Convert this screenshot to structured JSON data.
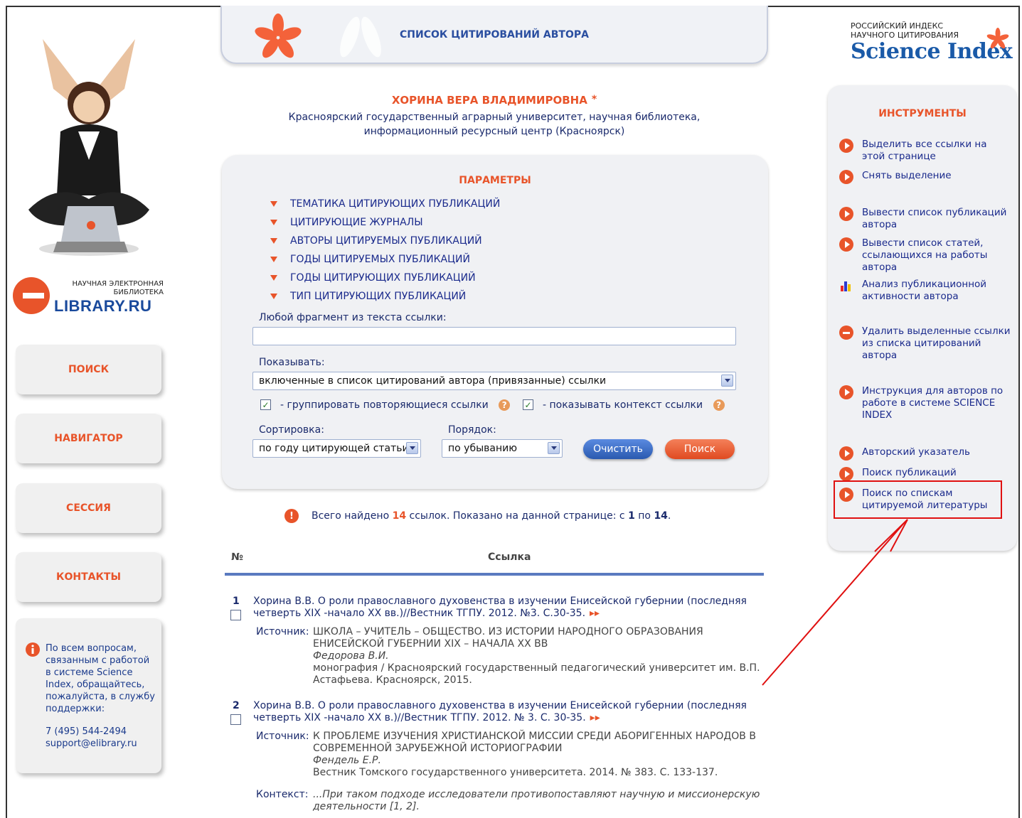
{
  "header": {
    "title": "СПИСОК ЦИТИРОВАНИЙ АВТОРА"
  },
  "author": {
    "name": "ХОРИНА ВЕРА ВЛАДИМИРОВНА",
    "org": "Красноярский государственный аграрный университет, научная библиотека, информационный ресурсный центр (Красноярск)"
  },
  "left": {
    "logo_tagline": "НАУЧНАЯ ЭЛЕКТРОННАЯ БИБЛИОТЕКА",
    "logo_brand": "LIBRARY.RU",
    "nav": [
      "ПОИСК",
      "НАВИГАТОР",
      "СЕССИЯ",
      "КОНТАКТЫ"
    ],
    "support_text": "По всем вопросам, связанным с работой в системе Science Index, обращайтесь, пожалуйста, в службу поддержки:",
    "phone": "7 (495) 544-2494",
    "email": "support@elibrary.ru"
  },
  "params": {
    "title": "ПАРАМЕТРЫ",
    "items": [
      "ТЕМАТИКА ЦИТИРУЮЩИХ ПУБЛИКАЦИЙ",
      "ЦИТИРУЮЩИЕ ЖУРНАЛЫ",
      "АВТОРЫ ЦИТИРУЕМЫХ ПУБЛИКАЦИЙ",
      "ГОДЫ ЦИТИРУЕМЫХ ПУБЛИКАЦИЙ",
      "ГОДЫ ЦИТИРУЮЩИХ ПУБЛИКАЦИЙ",
      "ТИП ЦИТИРУЮЩИХ ПУБЛИКАЦИЙ"
    ],
    "fragment_label": "Любой фрагмент из текста ссылки:",
    "fragment_value": "",
    "show_label": "Показывать:",
    "show_value": "включенные в список цитирований автора (привязанные) ссылки",
    "group_label": "- группировать повторяющиеся ссылки",
    "context_label": "- показывать контекст ссылки",
    "sort_label": "Сортировка:",
    "sort_value": "по году цитирующей статьи",
    "order_label": "Порядок:",
    "order_value": "по убыванию",
    "clear_button": "Очистить",
    "search_button": "Поиск"
  },
  "results": {
    "found_prefix": "Всего найдено",
    "found_count": "14",
    "found_mid": "ссылок. Показано на данной странице: с",
    "from": "1",
    "to_word": "по",
    "to": "14",
    "col_no": "№",
    "col_ref": "Ссылка",
    "source_label": "Источник:",
    "context_label": "Контекст:",
    "entries": [
      {
        "num": "1",
        "title": "Хорина В.В. О роли православного духовенства в изучении Енисейской губернии (последняя четверть XIX -начало XX вв.)//Вестник ТГПУ. 2012. №3. С.30-35.",
        "src_title": "ШКОЛА – УЧИТЕЛЬ – ОБЩЕСТВО. ИЗ ИСТОРИИ НАРОДНОГО ОБРАЗОВАНИЯ ЕНИСЕЙСКОЙ ГУБЕРНИИ XIX – НАЧАЛА XX ВВ",
        "src_author": "Федорова В.И.",
        "src_pub": "монография / Красноярский государственный педагогический университет им. В.П. Астафьева. Красноярск, 2015."
      },
      {
        "num": "2",
        "title": "Хорина В.В. О роли православного духовенства в изучении Енисейской губернии (последняя четверть XIX -начало XX в.)//Вестник ТГПУ. 2012. № 3. С. 30-35.",
        "src_title": "К ПРОБЛЕМЕ ИЗУЧЕНИЯ ХРИСТИАНСКОЙ МИССИИ СРЕДИ АБОРИГЕННЫХ НАРОДОВ В СОВРЕМЕННОЙ ЗАРУБЕЖНОЙ ИСТОРИОГРАФИИ",
        "src_author": "Фендель Е.Р.",
        "src_pub": "Вестник Томского государственного университета. 2014. № 383. С. 133-137.",
        "context": "...При таком подходе исследователи противопоставляют научную и миссионерскую деятельности [1, 2]."
      }
    ]
  },
  "right": {
    "logo_small": "РОССИЙСКИЙ ИНДЕКС НАУЧНОГО ЦИТИРОВАНИЯ",
    "logo_big": "Science Index",
    "tools_title": "ИНСТРУМЕНТЫ",
    "tools": [
      {
        "icon": "play-icon",
        "label": "Выделить все ссылки на этой странице"
      },
      {
        "icon": "play-icon",
        "label": "Снять выделение"
      },
      {
        "icon": "play-icon",
        "label": "Вывести список публикаций автора"
      },
      {
        "icon": "play-icon",
        "label": "Вывести список статей, ссылающихся на работы автора"
      },
      {
        "icon": "bar-chart-icon",
        "label": "Анализ публикационной активности автора"
      },
      {
        "icon": "minus-icon",
        "label": "Удалить выделенные ссылки из списка цитирований автора"
      },
      {
        "icon": "play-icon",
        "label": "Инструкция для авторов по работе в системе SCIENCE INDEX"
      },
      {
        "icon": "play-icon",
        "label": "Авторский указатель"
      },
      {
        "icon": "play-icon",
        "label": "Поиск публикаций"
      },
      {
        "icon": "play-icon",
        "label": "Поиск по спискам цитируемой литературы"
      }
    ]
  },
  "colors": {
    "accent": "#e8542a",
    "link": "#1a2a8c",
    "annotation": "#e01010"
  }
}
